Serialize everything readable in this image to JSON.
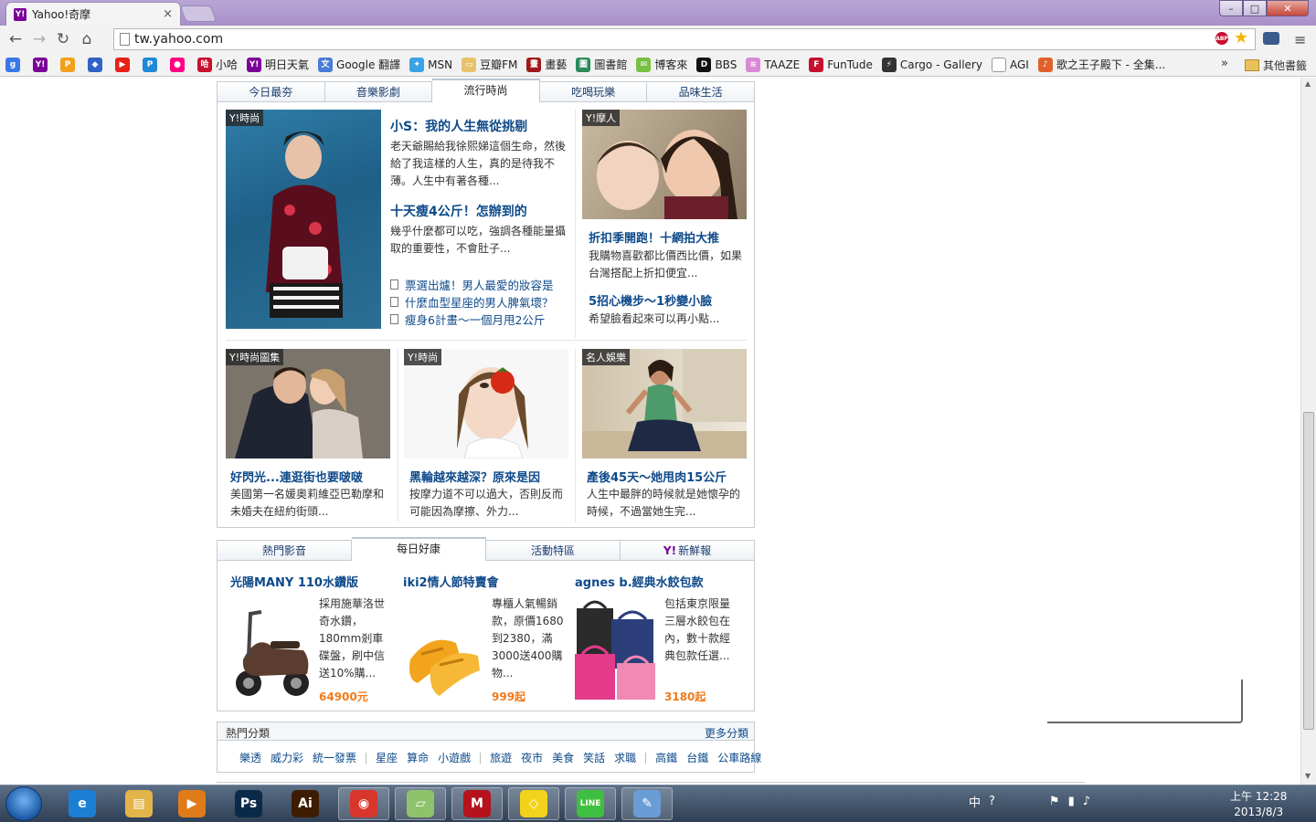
{
  "browser": {
    "tab_title": "Yahoo!奇摩",
    "tab_favicon": "Y!",
    "tab_close": "×",
    "url": "tw.yahoo.com",
    "abp_label": "ABP",
    "window_controls": {
      "minimize": "–",
      "maximize": "□",
      "close": "✕"
    },
    "nav": {
      "back": "←",
      "forward": "→",
      "reload": "↻",
      "home": "⌂"
    },
    "menu_icon": "≡",
    "star_icon": "★",
    "bookmarks": [
      {
        "label": "",
        "icon_color": "#3b78e7",
        "glyph": "g"
      },
      {
        "label": "",
        "icon_color": "#7b0099",
        "glyph": "Y!"
      },
      {
        "label": "",
        "icon_color": "#f2a01c",
        "glyph": "P"
      },
      {
        "label": "",
        "icon_color": "#2f63c6",
        "glyph": "◆"
      },
      {
        "label": "",
        "icon_color": "#e62117",
        "glyph": "▶"
      },
      {
        "label": "",
        "icon_color": "#1d8ad8",
        "glyph": "P"
      },
      {
        "label": "",
        "icon_color": "#ff0084",
        "glyph": "●"
      },
      {
        "label": "小哈",
        "icon_color": "#c8102e",
        "glyph": "哈"
      },
      {
        "label": "明日天氣",
        "icon_color": "#7b0099",
        "glyph": "Y!"
      },
      {
        "label": "Google 翻譯",
        "icon_color": "#4a7bd6",
        "glyph": "文"
      },
      {
        "label": "MSN",
        "icon_color": "#3aa3e3",
        "glyph": "✦"
      },
      {
        "label": "豆瓣FM",
        "icon_color": "#e6c36a",
        "glyph": "▭"
      },
      {
        "label": "畫藝",
        "icon_color": "#9e1a1a",
        "glyph": "畫"
      },
      {
        "label": "圖書館",
        "icon_color": "#2b8a5a",
        "glyph": "圖"
      },
      {
        "label": "博客來",
        "icon_color": "#77c043",
        "glyph": "✉"
      },
      {
        "label": "BBS",
        "icon_color": "#111111",
        "glyph": "D"
      },
      {
        "label": "TAAZE",
        "icon_color": "#d98ad4",
        "glyph": "≋"
      },
      {
        "label": "FunTude",
        "icon_color": "#c8102e",
        "glyph": "F"
      },
      {
        "label": "Cargo - Gallery",
        "icon_color": "#333333",
        "glyph": "⚡"
      },
      {
        "label": "AGI",
        "icon_color": "#ffffff",
        "glyph": ""
      },
      {
        "label": "歌之王子殿下 - 全集...",
        "icon_color": "#e0622a",
        "glyph": "♪"
      }
    ],
    "bookmarks_more": "»",
    "bookmarks_other": "其他書籤"
  },
  "fashion_panel": {
    "tabs": [
      "今日最夯",
      "音樂影劇",
      "流行時尚",
      "吃喝玩樂",
      "品味生活"
    ],
    "active_tab": 2,
    "lead": {
      "badge": "Y!時尚",
      "stories": [
        {
          "title": "小S：我的人生無從挑剔",
          "desc": "老天爺賜給我徐熙娣這個生命，然後給了我這樣的人生，真的是待我不薄。人生中有著各種..."
        },
        {
          "title": "十天瘦4公斤！怎辦到的",
          "desc": "幾乎什麼都可以吃，強調各種能量攝取的重要性，不會肚子..."
        }
      ],
      "links": [
        "票選出爐！男人最愛的妝容是",
        "什麼血型星座的男人脾氣壞？",
        "瘦身6計畫～一個月甩2公斤"
      ]
    },
    "side": {
      "badge": "Y!摩人",
      "stories": [
        {
          "title": "折扣季開跑！十網拍大推",
          "desc": "我購物喜歡都比價西比價，如果台灣搭配上折扣便宜..."
        },
        {
          "title": "5招心機步～1秒變小臉",
          "desc": "希望臉看起來可以再小點..."
        }
      ]
    },
    "cards": [
      {
        "badge": "Y!時尚圖集",
        "title": "好閃光...連逛街也要啵啵",
        "desc": "美國第一名媛奧莉維亞巴勒摩和未婚夫在紐約街頭..."
      },
      {
        "badge": "Y!時尚",
        "title": "黑輪越來越深？原來是因",
        "desc": "按摩力道不可以過大，否則反而可能因為摩擦、外力..."
      },
      {
        "badge": "名人娛樂",
        "title": "產後45天～她甩肉15公斤",
        "desc": "人生中最胖的時候就是她懷孕的時候，不過當她生完..."
      }
    ]
  },
  "shopping_panel": {
    "tabs": [
      "熱門影音",
      "每日好康",
      "活動特區",
      "新鮮報"
    ],
    "tab_logo": "Y!",
    "active_tab": 1,
    "items": [
      {
        "title": "光陽MANY 110水鑽版",
        "desc": "採用施華洛世奇水鑽，180mm剎車碟盤，刷中信送10%購...",
        "price": "64900元"
      },
      {
        "title": "iki2情人節特賣會",
        "desc": "專櫃人氣暢銷款，原價1680到2380，滿3000送400購物...",
        "price": "999起"
      },
      {
        "title": "agnes b.經典水餃包款",
        "desc": "包括東京限量三層水餃包在內，數十款經典包款任選...",
        "price": "3180起"
      }
    ]
  },
  "categories": {
    "title": "熱門分類",
    "more": "更多分類",
    "groups": [
      [
        "樂透",
        "威力彩",
        "統一發票"
      ],
      [
        "星座",
        "算命",
        "小遊戲"
      ],
      [
        "旅遊",
        "夜市",
        "美食",
        "笑話",
        "求職"
      ],
      [
        "高鐵",
        "台鐵",
        "公車路線"
      ]
    ]
  },
  "taskbar": {
    "apps": [
      {
        "name": "ie",
        "glyph": "e",
        "color": "#1b7fd4"
      },
      {
        "name": "explorer",
        "glyph": "▤",
        "color": "#e3b44a"
      },
      {
        "name": "media-player",
        "glyph": "▶",
        "color": "#e07b1a"
      },
      {
        "name": "photoshop",
        "glyph": "Ps",
        "color": "#0b2a4a"
      },
      {
        "name": "illustrator",
        "glyph": "Ai",
        "color": "#3d1c00"
      },
      {
        "name": "chrome",
        "glyph": "◉",
        "color": "#d8362b"
      },
      {
        "name": "files",
        "glyph": "▱",
        "color": "#8fc36b"
      },
      {
        "name": "mcafee",
        "glyph": "M",
        "color": "#b5121b"
      },
      {
        "name": "keychain",
        "glyph": "◇",
        "color": "#f2d21b"
      },
      {
        "name": "line",
        "glyph": "LINE",
        "color": "#3fbf3f"
      },
      {
        "name": "paint",
        "glyph": "✎",
        "color": "#6a9cd6"
      }
    ],
    "tray": {
      "ime": "中",
      "help": "?",
      "flag": "⚑",
      "signal": "▮",
      "volume": "♪"
    },
    "clock_time": "上午 12:28",
    "clock_date": "2013/8/3"
  }
}
